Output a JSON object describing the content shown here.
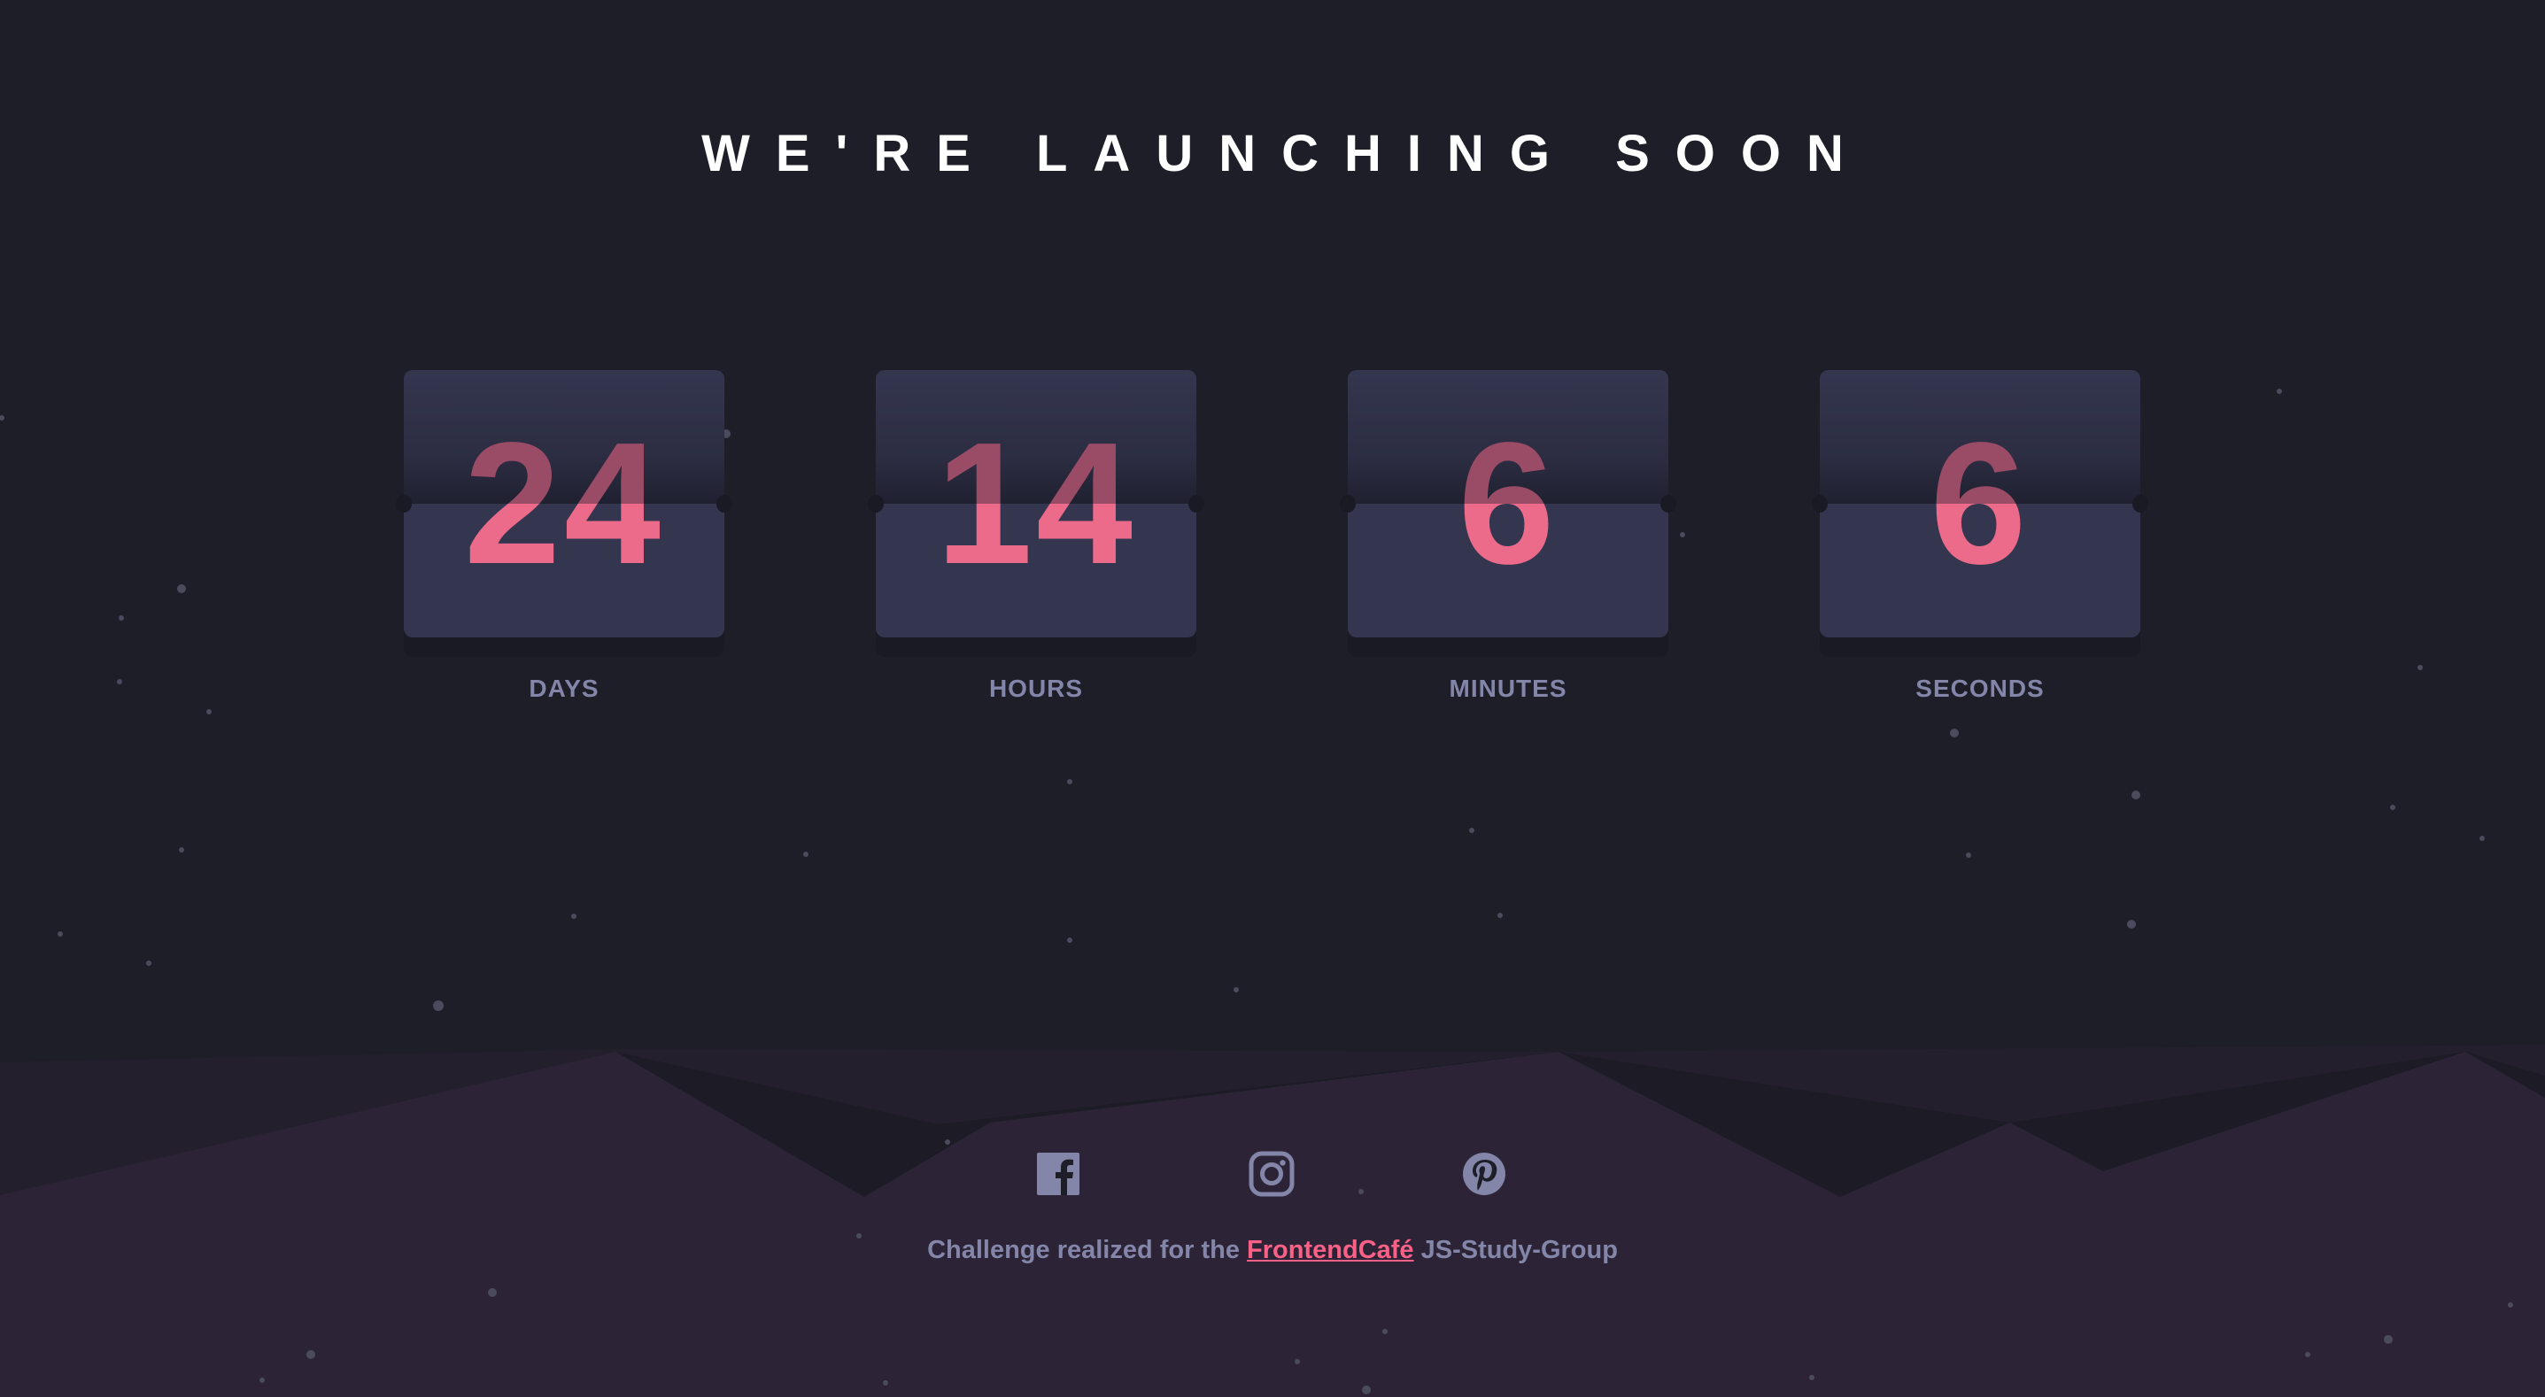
{
  "header": {
    "title": "WE'RE LAUNCHING SOON"
  },
  "countdown": [
    {
      "value": "24",
      "label": "DAYS"
    },
    {
      "value": "14",
      "label": "HOURS"
    },
    {
      "value": "6",
      "label": "MINUTES"
    },
    {
      "value": "6",
      "label": "SECONDS"
    }
  ],
  "socials": [
    {
      "icon": "facebook-icon"
    },
    {
      "icon": "instagram-icon"
    },
    {
      "icon": "pinterest-icon"
    }
  ],
  "footer": {
    "prefix": "Challenge realized for the ",
    "link_text": "FrontendCafé",
    "suffix": " JS-Study-Group"
  },
  "colors": {
    "background": "#1e1e29",
    "accent": "#fb6087",
    "card": "#343650",
    "muted_text": "#8385a9",
    "hills": "#2c2436"
  }
}
